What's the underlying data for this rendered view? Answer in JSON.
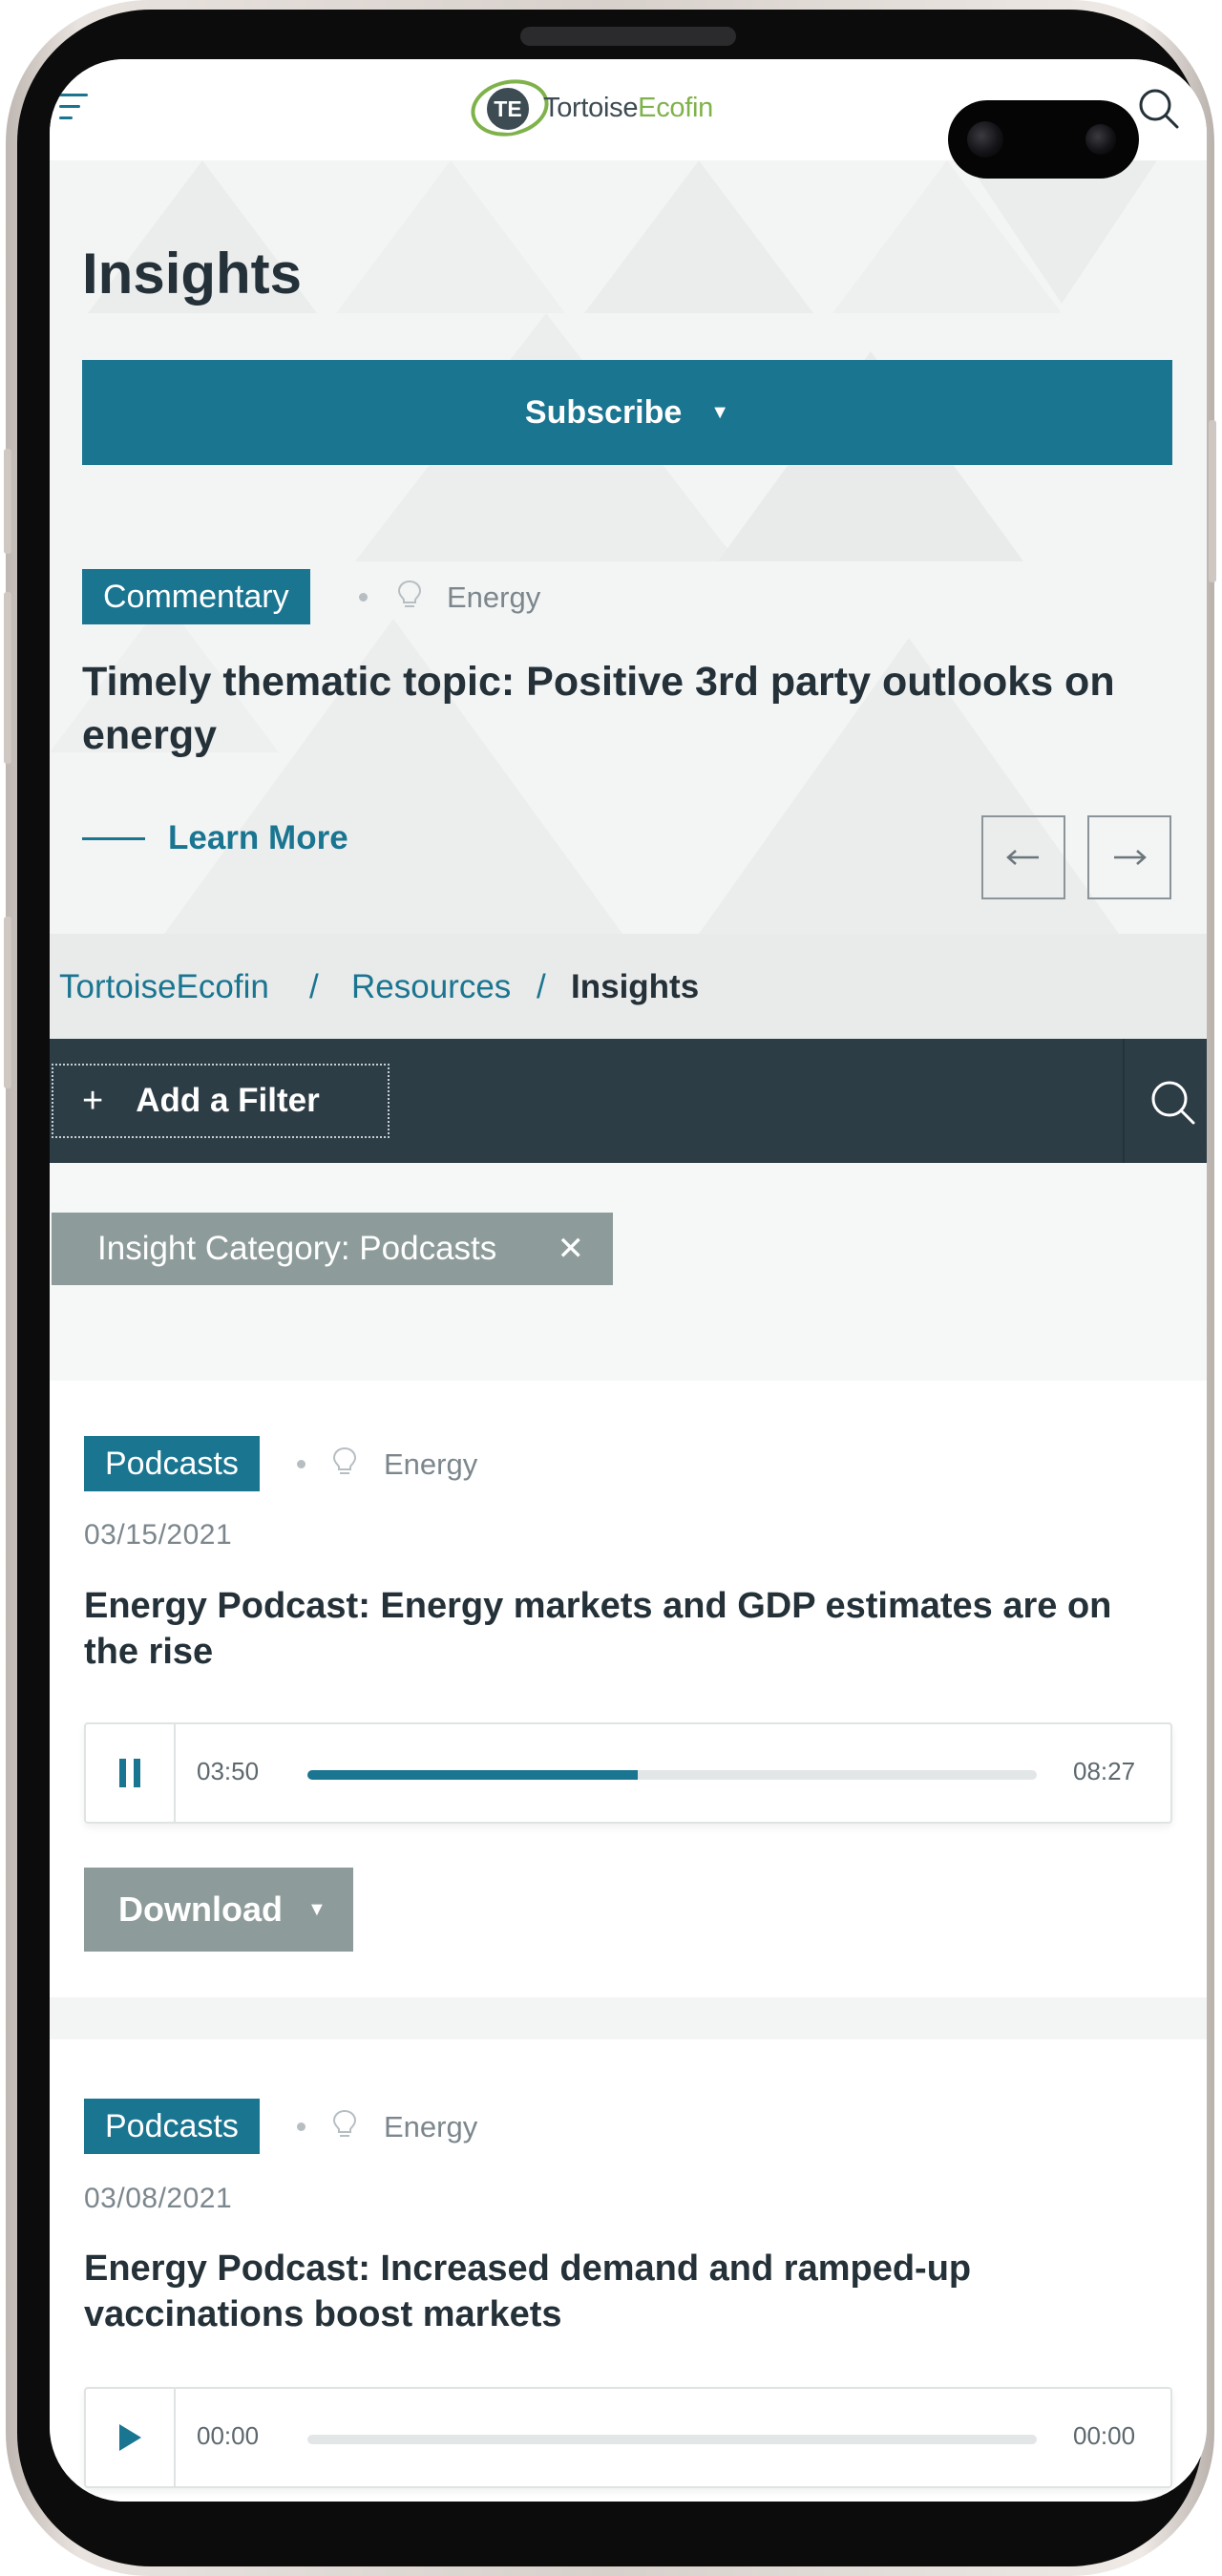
{
  "header": {
    "logo_badge": "TE",
    "logo_text_a": "Tortoise",
    "logo_text_b": "Ecofin"
  },
  "hero": {
    "title": "Insights",
    "subscribe_label": "Subscribe",
    "tag": "Commentary",
    "topic": "Energy",
    "headline": "Timely thematic topic: Positive 3rd party outlooks on energy",
    "learn_more": "Learn More",
    "prev_arrow": "←",
    "next_arrow": "→"
  },
  "breadcrumb": {
    "items": [
      "TortoiseEcofin",
      "Resources",
      "Insights"
    ],
    "separator": "/"
  },
  "filters": {
    "add_label": "Add a Filter",
    "plus": "+",
    "chip_label": "Insight Category: Podcasts",
    "chip_close": "✕"
  },
  "cards": [
    {
      "tag": "Podcasts",
      "topic": "Energy",
      "date": "03/15/2021",
      "title": "Energy Podcast: Energy markets and GDP estimates are on the rise",
      "current_time": "03:50",
      "duration": "08:27",
      "progress": 0.453,
      "state": "playing",
      "download_label": "Download"
    },
    {
      "tag": "Podcasts",
      "topic": "Energy",
      "date": "03/08/2021",
      "title": "Energy Podcast: Increased demand and ramped-up vaccinations boost markets",
      "current_time": "00:00",
      "duration": "00:00",
      "progress": 0,
      "state": "paused"
    }
  ],
  "colors": {
    "primary": "#1a7591",
    "dark": "#2d3d45",
    "heading": "#243138",
    "chip": "#8d9c9a",
    "brand_green": "#7fb24a"
  },
  "icons": {
    "menu": "hamburger-icon",
    "search": "search-icon",
    "topic": "lightbulb-icon",
    "pause": "pause-icon",
    "play": "play-icon"
  }
}
